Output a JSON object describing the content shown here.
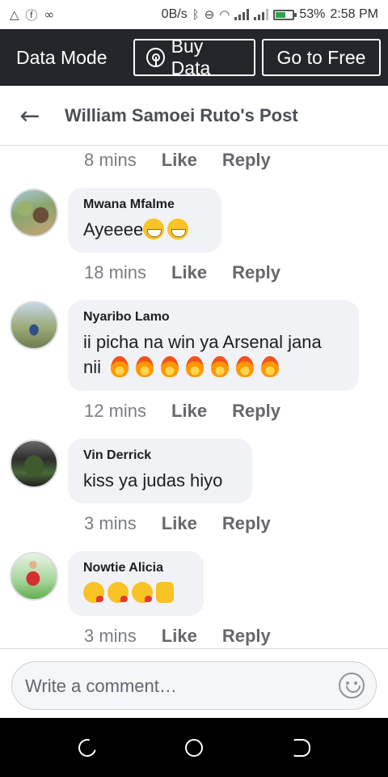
{
  "status_bar": {
    "net_speed": "0B/s",
    "battery": "53%",
    "time": "2:58 PM",
    "battery_level": 0.53,
    "left_icons": [
      "warning-triangle-icon",
      "facebook-icon",
      "voicemail-icon"
    ],
    "right_icons": [
      "bluetooth-icon",
      "do-not-disturb-icon",
      "wifi-icon",
      "signal-icon",
      "signal-icon",
      "battery-icon"
    ]
  },
  "data_mode": {
    "label": "Data Mode",
    "buy_label": "Buy Data",
    "free_label": "Go to Free",
    "buy_icon": "broadcast-icon"
  },
  "header": {
    "title": "William Samoei Ruto's Post",
    "back_icon": "arrow-left-icon"
  },
  "comments": [
    {
      "time": "8 mins",
      "like": "Like",
      "reply": "Reply"
    },
    {
      "name": "Mwana Mfalme",
      "text": "Ayeeee",
      "emoji": [
        "grinning-face",
        "grinning-face"
      ],
      "time": "18 mins",
      "like": "Like",
      "reply": "Reply"
    },
    {
      "name": "Nyaribo Lamo",
      "text_line1": "ii picha na win ya Arsenal jana",
      "text_line2": "nii",
      "emoji": [
        "fire",
        "fire",
        "fire",
        "fire",
        "fire",
        "fire",
        "fire"
      ],
      "time": "12 mins",
      "like": "Like",
      "reply": "Reply"
    },
    {
      "name": "Vin Derrick",
      "text": "kiss ya judas hiyo",
      "time": "3 mins",
      "like": "Like",
      "reply": "Reply"
    },
    {
      "name": "Nowtie Alicia",
      "emoji": [
        "face-blowing-kiss",
        "face-blowing-kiss",
        "face-blowing-kiss",
        "raised-fist"
      ],
      "time": "3 mins",
      "like": "Like",
      "reply": "Reply"
    }
  ],
  "composer": {
    "placeholder": "Write a comment…",
    "emoji_icon": "smiley-icon"
  },
  "colors": {
    "data_bar_bg": "#23272b",
    "bubble_bg": "#f0f2f5",
    "meta_text": "#65676b",
    "nav_bg": "#000000"
  }
}
